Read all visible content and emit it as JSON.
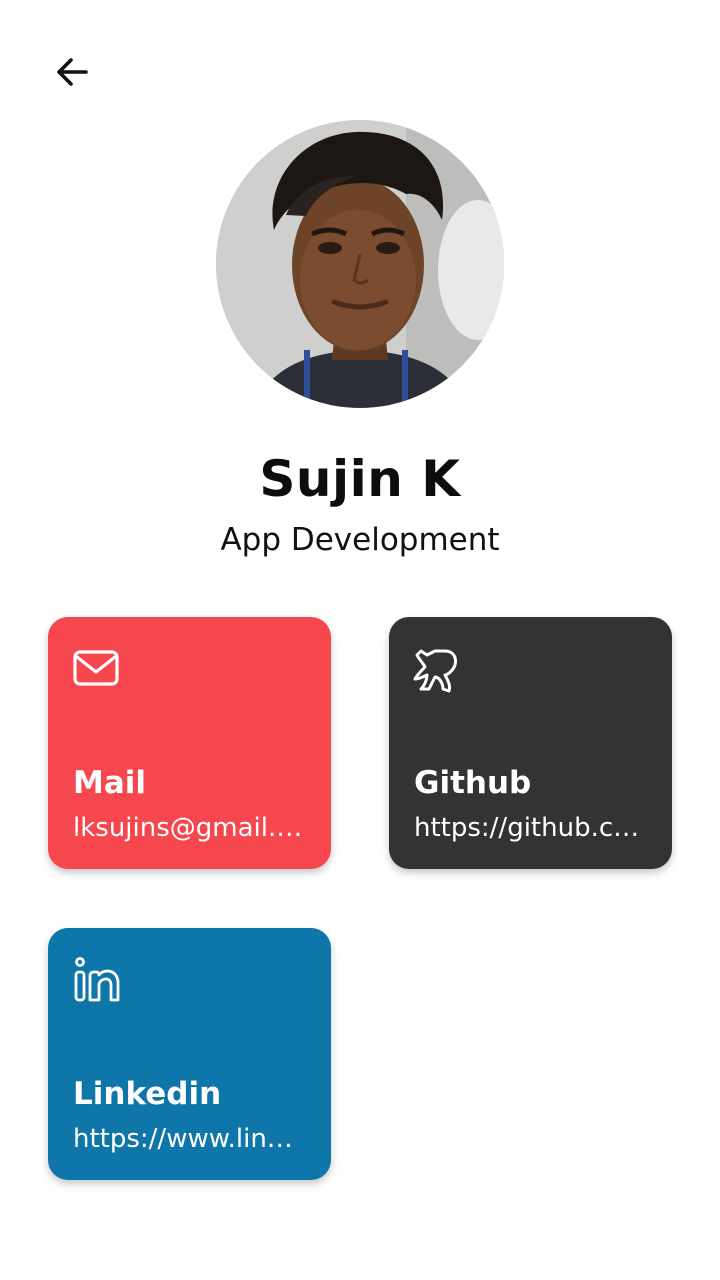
{
  "profile": {
    "name": "Sujin K",
    "role": "App Development"
  },
  "cards": {
    "mail": {
      "title": "Mail",
      "subtitle": "lksujins@gmail.…",
      "icon": "mail-icon",
      "color": "#F6474F"
    },
    "github": {
      "title": "Github",
      "subtitle": "https://github.c…",
      "icon": "github-icon",
      "color": "#333333"
    },
    "linkedin": {
      "title": "Linkedin",
      "subtitle": "https://www.lin…",
      "icon": "linkedin-icon",
      "color": "#0E76A8"
    }
  },
  "header": {
    "back_icon": "arrow-left-icon"
  }
}
